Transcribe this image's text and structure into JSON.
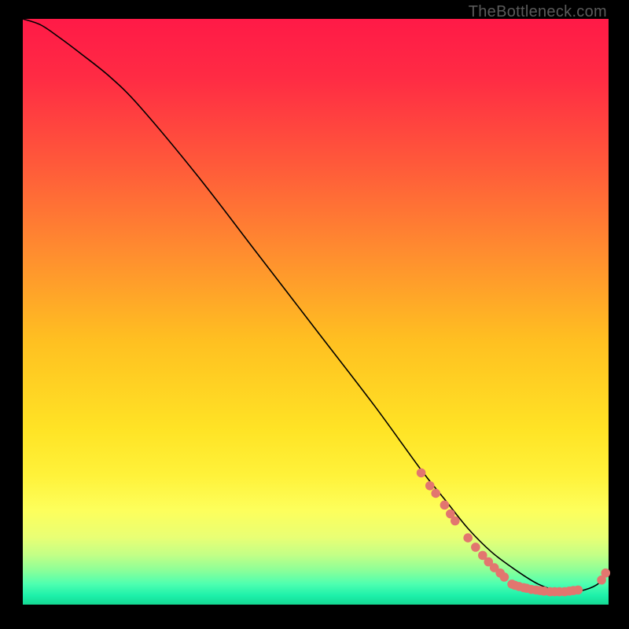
{
  "watermark": "TheBottleneck.com",
  "colors": {
    "dot": "#e2766f",
    "curve": "#000000",
    "gradient_stops": [
      {
        "offset": 0.0,
        "color": "#ff1a47"
      },
      {
        "offset": 0.1,
        "color": "#ff2b44"
      },
      {
        "offset": 0.25,
        "color": "#ff5a3a"
      },
      {
        "offset": 0.4,
        "color": "#ff8d2f"
      },
      {
        "offset": 0.55,
        "color": "#ffc021"
      },
      {
        "offset": 0.7,
        "color": "#ffe325"
      },
      {
        "offset": 0.78,
        "color": "#fff23a"
      },
      {
        "offset": 0.84,
        "color": "#fdff5c"
      },
      {
        "offset": 0.885,
        "color": "#e9ff74"
      },
      {
        "offset": 0.915,
        "color": "#c3ff86"
      },
      {
        "offset": 0.94,
        "color": "#8fff97"
      },
      {
        "offset": 0.965,
        "color": "#4dffb0"
      },
      {
        "offset": 0.985,
        "color": "#1cf0aa"
      },
      {
        "offset": 1.0,
        "color": "#15d892"
      }
    ]
  },
  "chart_data": {
    "type": "line",
    "title": "",
    "xlabel": "",
    "ylabel": "",
    "xlim": [
      0,
      100
    ],
    "ylim": [
      0,
      100
    ],
    "legend": false,
    "grid": false,
    "series": [
      {
        "name": "curve",
        "x": [
          0,
          3,
          6,
          10,
          15,
          20,
          30,
          40,
          50,
          60,
          68,
          72,
          76,
          80,
          84,
          88,
          92,
          95,
          98,
          100
        ],
        "y": [
          100,
          99,
          97,
          94,
          90,
          85,
          73,
          60,
          47,
          34,
          23,
          18,
          13,
          9,
          6,
          3.5,
          2.2,
          2.3,
          3.4,
          5.5
        ]
      }
    ],
    "dots": [
      {
        "x": 68.0,
        "y": 22.5
      },
      {
        "x": 69.5,
        "y": 20.3
      },
      {
        "x": 70.5,
        "y": 19.0
      },
      {
        "x": 72.0,
        "y": 17.0
      },
      {
        "x": 73.0,
        "y": 15.5
      },
      {
        "x": 73.8,
        "y": 14.3
      },
      {
        "x": 76.0,
        "y": 11.4
      },
      {
        "x": 77.3,
        "y": 9.8
      },
      {
        "x": 78.5,
        "y": 8.4
      },
      {
        "x": 79.5,
        "y": 7.3
      },
      {
        "x": 80.5,
        "y": 6.3
      },
      {
        "x": 81.5,
        "y": 5.4
      },
      {
        "x": 82.2,
        "y": 4.7
      },
      {
        "x": 83.5,
        "y": 3.5
      },
      {
        "x": 84.0,
        "y": 3.3
      },
      {
        "x": 84.7,
        "y": 3.1
      },
      {
        "x": 85.5,
        "y": 2.9
      },
      {
        "x": 86.0,
        "y": 2.8
      },
      {
        "x": 86.8,
        "y": 2.6
      },
      {
        "x": 87.6,
        "y": 2.5
      },
      {
        "x": 88.3,
        "y": 2.4
      },
      {
        "x": 89.0,
        "y": 2.3
      },
      {
        "x": 90.0,
        "y": 2.2
      },
      {
        "x": 90.8,
        "y": 2.2
      },
      {
        "x": 91.6,
        "y": 2.2
      },
      {
        "x": 92.5,
        "y": 2.2
      },
      {
        "x": 93.3,
        "y": 2.3
      },
      {
        "x": 94.0,
        "y": 2.4
      },
      {
        "x": 94.8,
        "y": 2.5
      },
      {
        "x": 98.8,
        "y": 4.2
      },
      {
        "x": 99.5,
        "y": 5.4
      }
    ]
  }
}
